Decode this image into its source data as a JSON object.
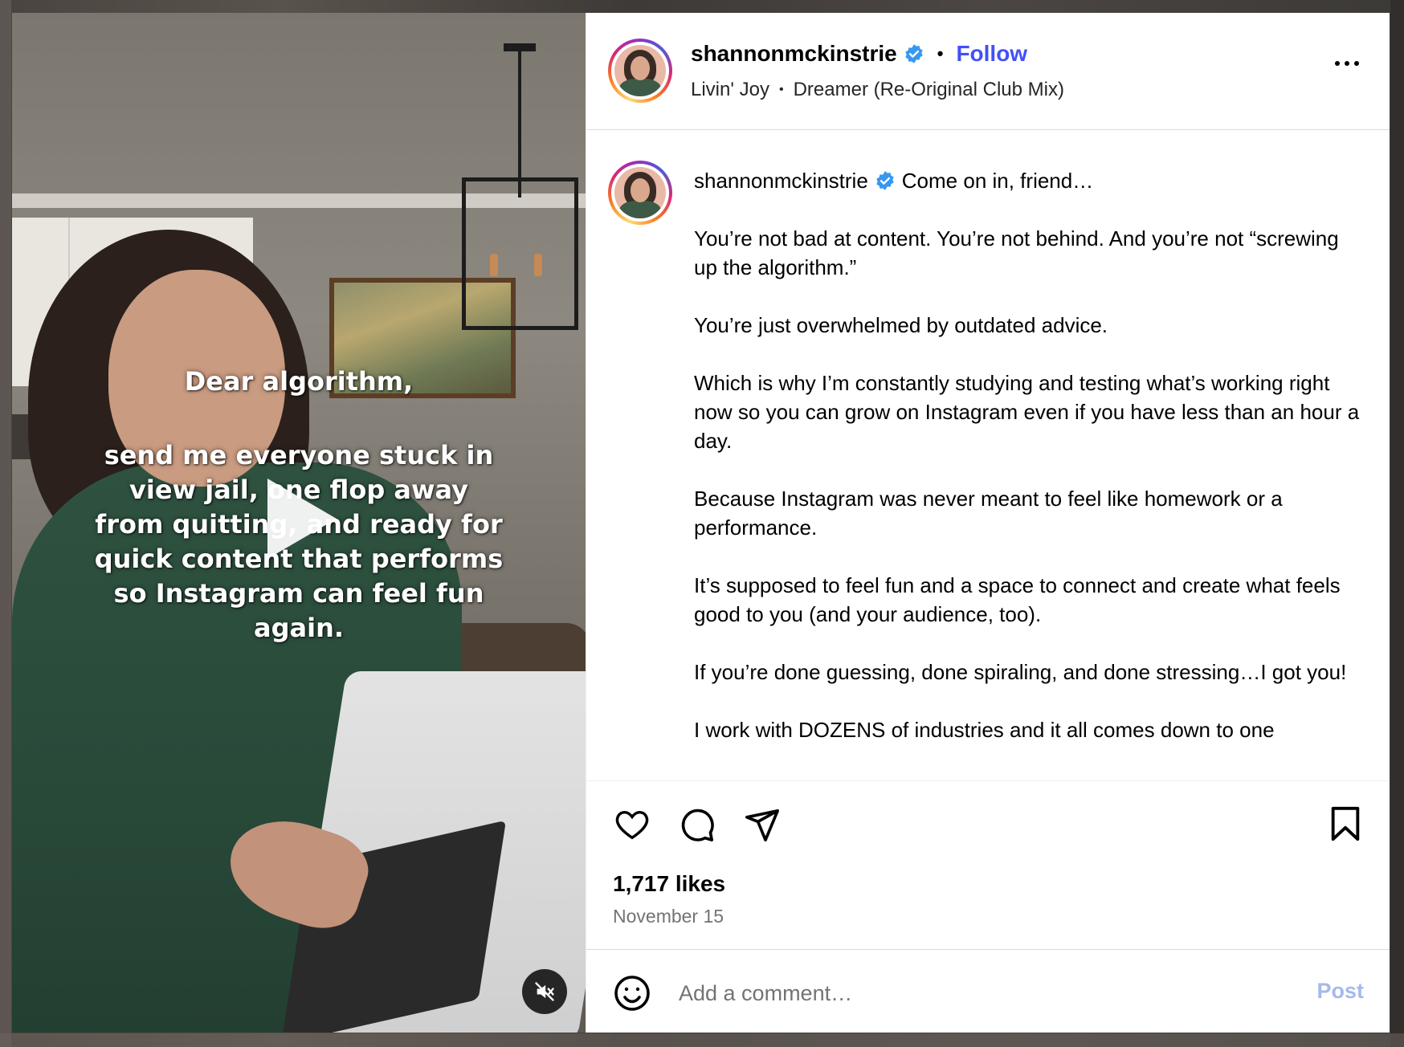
{
  "post": {
    "username": "shannonmckinstrie",
    "follow_label": "Follow",
    "dot": "•",
    "audio": {
      "artist": "Livin' Joy",
      "separator": "•",
      "track": "Dreamer (Re-Original Club Mix)"
    },
    "more_icon": "more-horizontal-icon",
    "verified_icon": "verified-badge-icon",
    "verified_color": "#3897f0"
  },
  "media": {
    "overlay_line1": "Dear algorithm,",
    "overlay_line2": "send me everyone stuck in view jail, one flop away from quitting, and ready for quick content that performs so Instagram can feel fun again.",
    "play_icon": "play-icon",
    "mute_icon": "muted-speaker-icon"
  },
  "caption": {
    "username": "shannonmckinstrie",
    "first_line": "Come on in, friend…",
    "paragraphs": [
      "You’re not bad at content. You’re not behind. And you’re not “screwing up the algorithm.”",
      "You’re just overwhelmed by outdated advice.",
      "Which is why I’m constantly studying and testing what’s working right now so you can grow on Instagram even if you have less than an hour a day.",
      "Because Instagram was never meant to feel like homework or a performance.",
      "It’s supposed to feel fun and a space to connect and create what feels good to you (and your audience, too).",
      "If you’re done guessing, done spiraling, and done stressing…I got you!",
      "I work with DOZENS of industries and it all comes down to one"
    ]
  },
  "actions": {
    "like_icon": "heart-icon",
    "comment_icon": "comment-bubble-icon",
    "share_icon": "share-paper-plane-icon",
    "save_icon": "bookmark-icon",
    "likes": "1,717 likes",
    "date": "November 15"
  },
  "comment": {
    "emoji_icon": "emoji-smile-icon",
    "placeholder": "Add a comment…",
    "post_label": "Post",
    "post_color": "#a5b9ee"
  },
  "colors": {
    "follow": "#4150f7",
    "text": "#000000",
    "muted": "#737373"
  }
}
